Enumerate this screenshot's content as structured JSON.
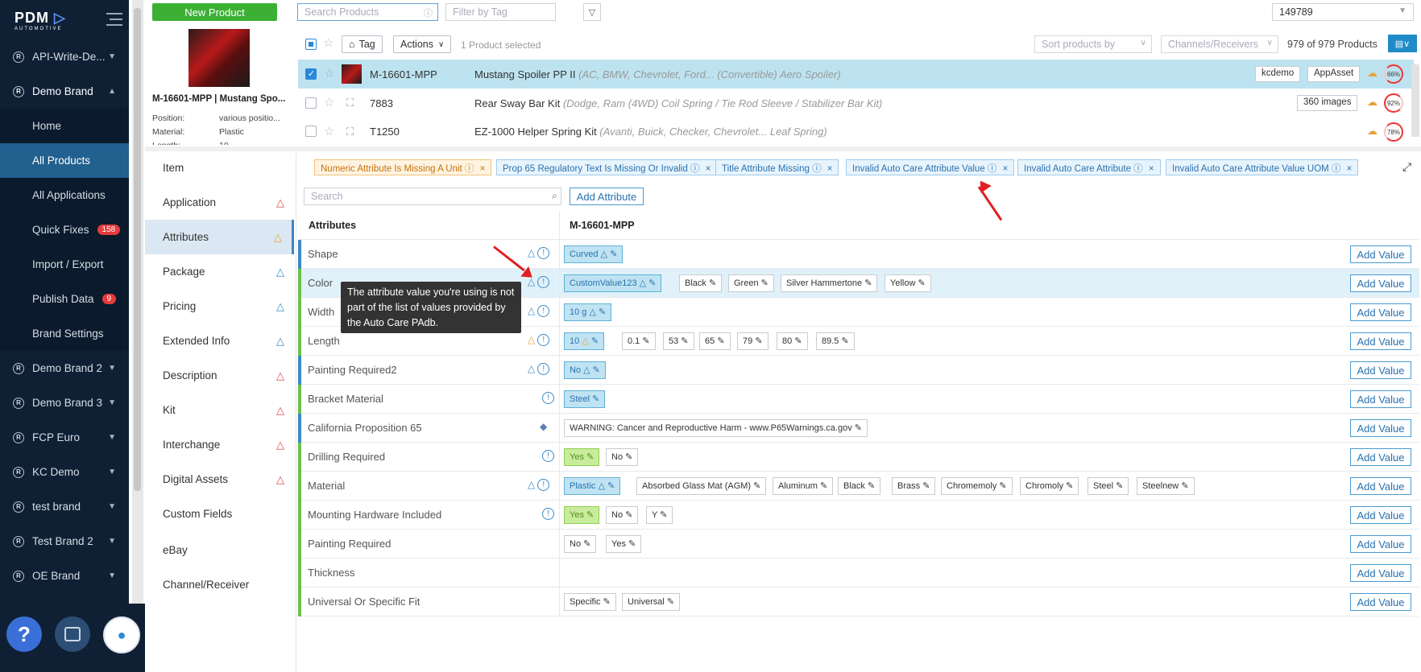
{
  "sidebar": {
    "logo": "PDM",
    "logo_sub": "AUTOMOTIVE",
    "items": [
      {
        "label": "API-Write-De..."
      },
      {
        "label": "Demo Brand"
      },
      {
        "label": "Home"
      },
      {
        "label": "All Products"
      },
      {
        "label": "All Applications"
      },
      {
        "label": "Quick Fixes",
        "badge": "158"
      },
      {
        "label": "Import / Export"
      },
      {
        "label": "Publish Data",
        "badge": "9"
      },
      {
        "label": "Brand Settings"
      },
      {
        "label": "Demo Brand 2"
      },
      {
        "label": "Demo Brand 3"
      },
      {
        "label": "FCP Euro"
      },
      {
        "label": "KC Demo"
      },
      {
        "label": "test brand"
      },
      {
        "label": "Test Brand 2"
      },
      {
        "label": "OE Brand"
      }
    ],
    "help": "?"
  },
  "topbar": {
    "new_product": "New Product",
    "search_placeholder": "Search Products",
    "tag_placeholder": "Filter by Tag",
    "brand_select": "149789"
  },
  "preview": {
    "title": "M-16601-MPP | Mustang Spo...",
    "position_label": "Position:",
    "position_value": "various positio...",
    "material_label": "Material:",
    "material_value": "Plastic",
    "length_label": "Length:",
    "length_value": "10"
  },
  "productlist": {
    "tag_btn": "Tag",
    "actions_btn": "Actions",
    "selected": "1 Product selected",
    "sort": "Sort products by",
    "channels": "Channels/Receivers",
    "count": "979 of 979 Products",
    "rows": [
      {
        "sku": "M-16601-MPP",
        "desc": "Mustang Spoiler PP II",
        "detail": "(AC, BMW, Chevrolet, Ford... (Convertible) Aero Spoiler)",
        "tags": [
          "kcdemo",
          "AppAsset"
        ],
        "score": "66%"
      },
      {
        "sku": "7883",
        "desc": "Rear Sway Bar Kit",
        "detail": "(Dodge, Ram (4WD) Coil Spring / Tie Rod Sleeve / Stabilizer Bar Kit)",
        "tags": [
          "360 images"
        ],
        "score": "92%"
      },
      {
        "sku": "T1250",
        "desc": "EZ-1000 Helper Spring Kit",
        "detail": "(Avanti, Buick, Checker, Chevrolet... Leaf Spring)",
        "tags": [],
        "score": "78%"
      }
    ]
  },
  "tabs": [
    "Item",
    "Application",
    "Attributes",
    "Package",
    "Pricing",
    "Extended Info",
    "Description",
    "Kit",
    "Interchange",
    "Digital Assets",
    "Custom Fields",
    "eBay",
    "Channel/Receiver"
  ],
  "chips": [
    "Numeric Attribute Is Missing A Unit",
    "Prop 65 Regulatory Text Is Missing Or Invalid",
    "Title Attribute Missing",
    "Invalid Auto Care Attribute Value",
    "Invalid Auto Care Attribute",
    "Invalid Auto Care Attribute Value UOM"
  ],
  "attributes": {
    "search_placeholder": "Search",
    "add_attribute": "Add Attribute",
    "col_attr": "Attributes",
    "col_sku": "M-16601-MPP",
    "add_value": "Add Value",
    "tooltip": "The attribute value you're using is not part of the list of values provided by the Auto Care PAdb.",
    "rows": [
      {
        "name": "Shape",
        "values": [
          "Curved"
        ]
      },
      {
        "name": "Color",
        "values": [
          "CustomValue123",
          "Black",
          "Green",
          "Silver Hammertone",
          "Yellow"
        ]
      },
      {
        "name": "Width",
        "values": [
          "10 g"
        ]
      },
      {
        "name": "Length",
        "values": [
          "10",
          "0.1",
          "53",
          "65",
          "79",
          "80",
          "89.5"
        ]
      },
      {
        "name": "Painting Required2",
        "values": [
          "No"
        ]
      },
      {
        "name": "Bracket Material",
        "values": [
          "Steel"
        ]
      },
      {
        "name": "California Proposition 65",
        "values": [
          "WARNING: Cancer and Reproductive Harm - www.P65Warnings.ca.gov"
        ]
      },
      {
        "name": "Drilling Required",
        "values": [
          "Yes",
          "No"
        ]
      },
      {
        "name": "Material",
        "values": [
          "Plastic",
          "Absorbed Glass Mat (AGM)",
          "Aluminum",
          "Black",
          "Brass",
          "Chromemoly",
          "Chromoly",
          "Steel",
          "Steelnew"
        ]
      },
      {
        "name": "Mounting Hardware Included",
        "values": [
          "Yes",
          "No",
          "Y"
        ]
      },
      {
        "name": "Painting Required",
        "values": [
          "No",
          "Yes"
        ]
      },
      {
        "name": "Thickness",
        "values": []
      },
      {
        "name": "Universal Or Specific Fit",
        "values": [
          "Specific",
          "Universal"
        ]
      }
    ]
  }
}
